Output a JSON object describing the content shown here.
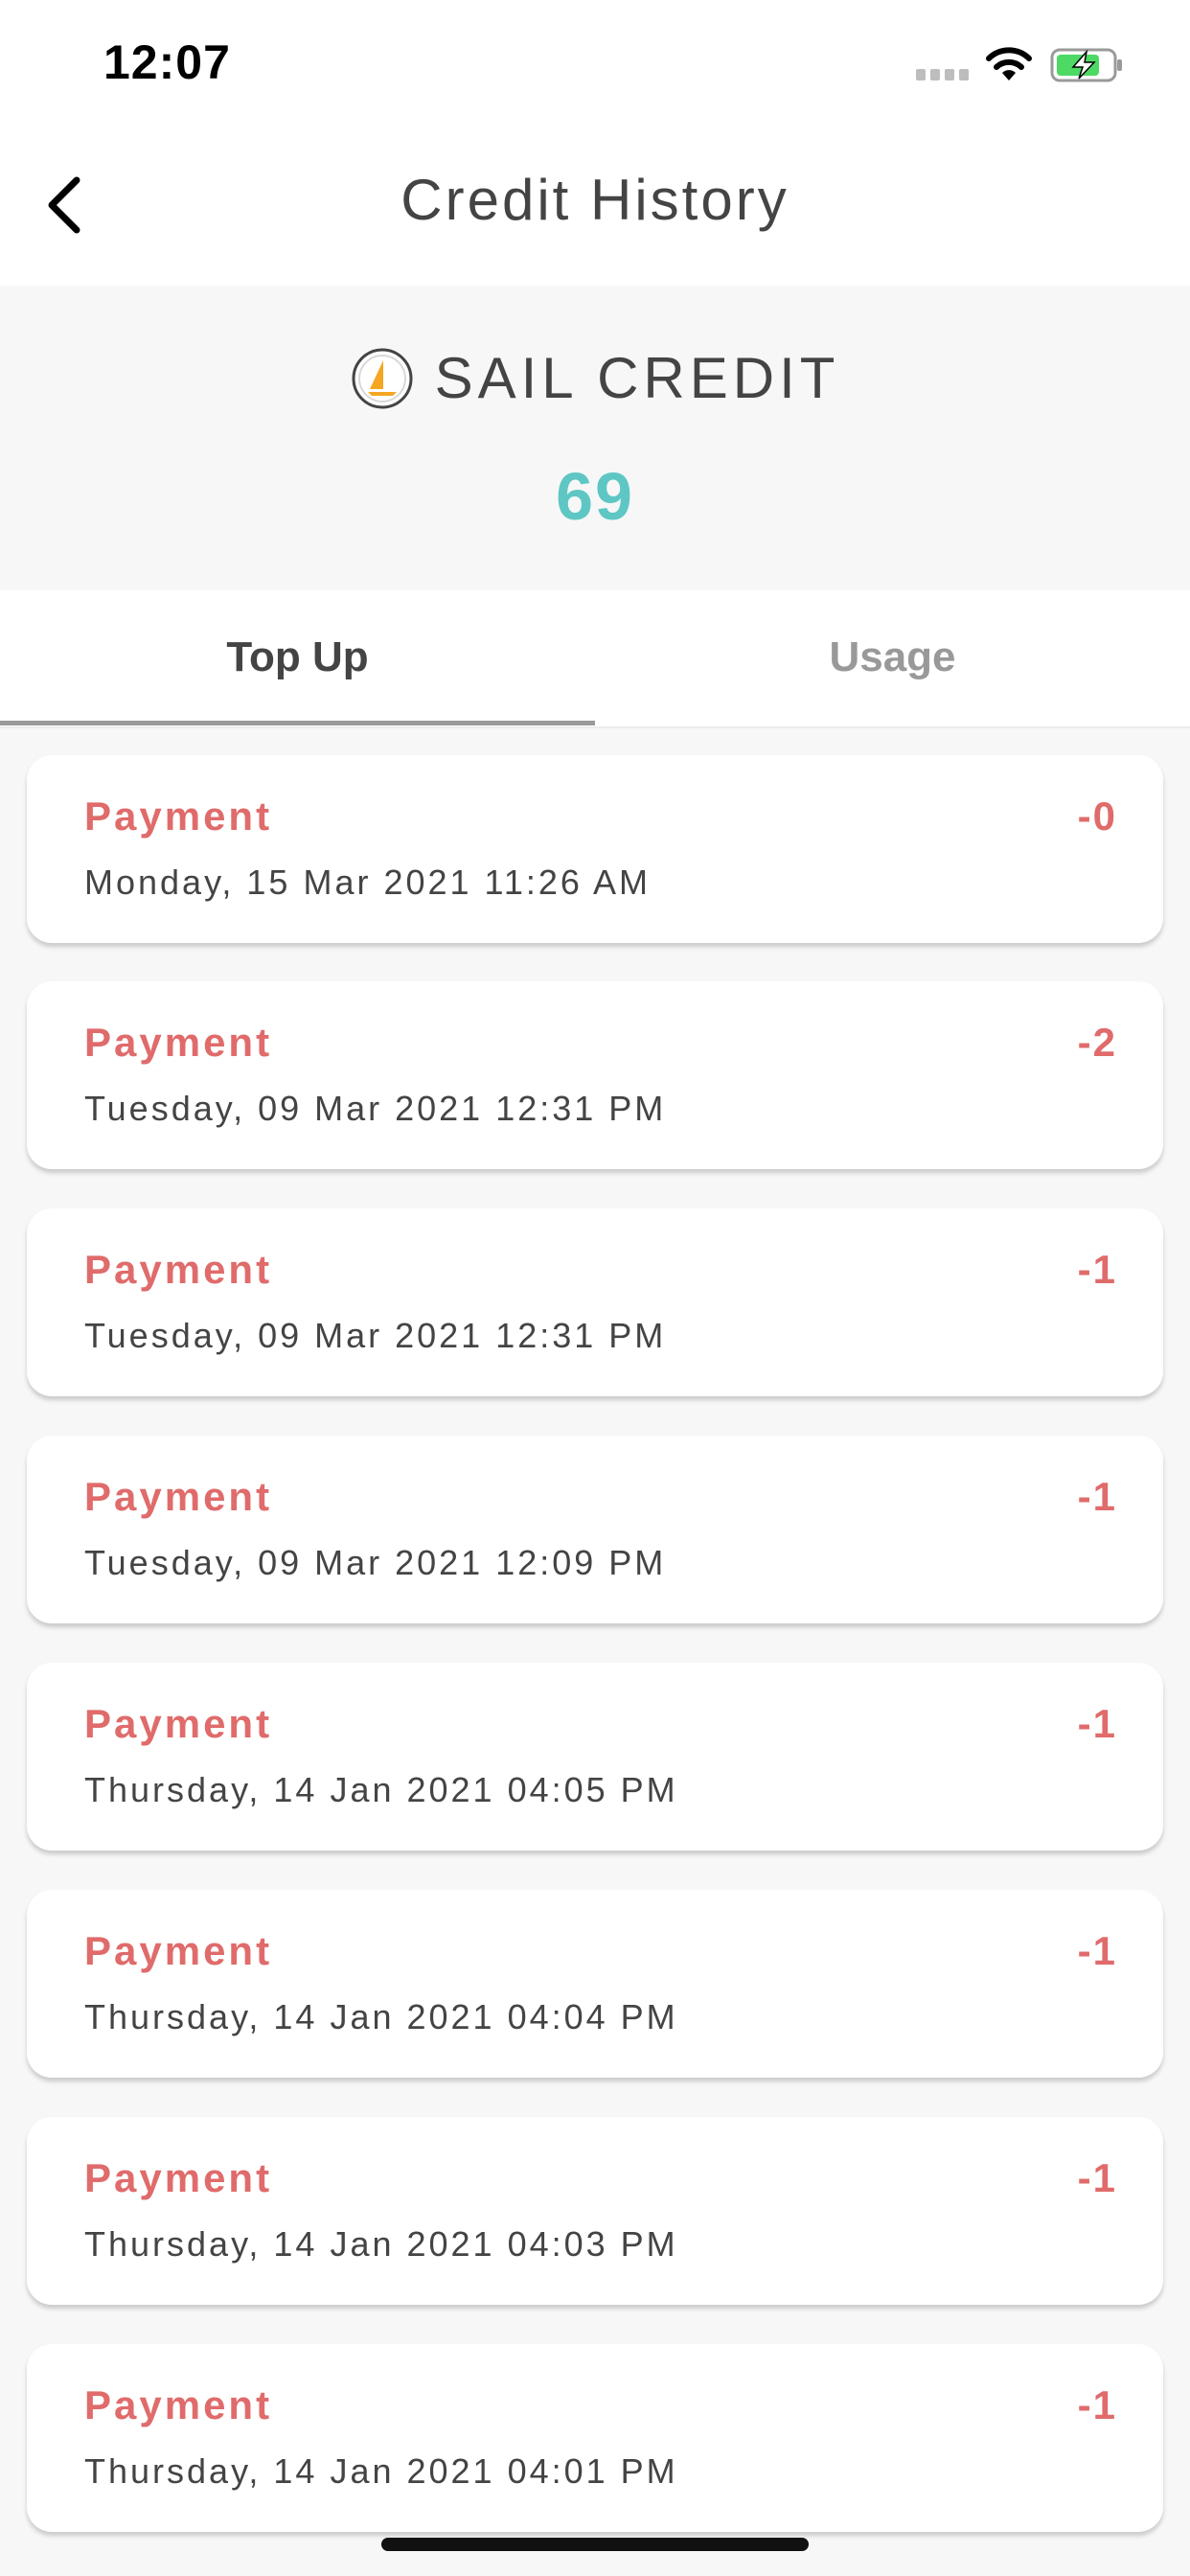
{
  "status_bar": {
    "time": "12:07"
  },
  "nav": {
    "title": "Credit History",
    "back_icon": "chevron-left-icon"
  },
  "credit": {
    "label": "SAIL CREDIT",
    "value": "69",
    "logo_icon": "sailboat-logo-icon",
    "value_color": "#5ec7c4"
  },
  "tabs": [
    {
      "label": "Top Up",
      "active": true
    },
    {
      "label": "Usage",
      "active": false
    }
  ],
  "transactions": [
    {
      "type": "Payment",
      "amount": "-0",
      "date": "Monday, 15 Mar 2021 11:26 AM"
    },
    {
      "type": "Payment",
      "amount": "-2",
      "date": "Tuesday, 09 Mar 2021 12:31 PM"
    },
    {
      "type": "Payment",
      "amount": "-1",
      "date": "Tuesday, 09 Mar 2021 12:31 PM"
    },
    {
      "type": "Payment",
      "amount": "-1",
      "date": "Tuesday, 09 Mar 2021 12:09 PM"
    },
    {
      "type": "Payment",
      "amount": "-1",
      "date": "Thursday, 14 Jan 2021 04:05 PM"
    },
    {
      "type": "Payment",
      "amount": "-1",
      "date": "Thursday, 14 Jan 2021 04:04 PM"
    },
    {
      "type": "Payment",
      "amount": "-1",
      "date": "Thursday, 14 Jan 2021 04:03 PM"
    },
    {
      "type": "Payment",
      "amount": "-1",
      "date": "Thursday, 14 Jan 2021 04:01 PM"
    }
  ],
  "colors": {
    "accent": "#5ec7c4",
    "negative": "#e06b6b",
    "battery": "#4cd964"
  }
}
